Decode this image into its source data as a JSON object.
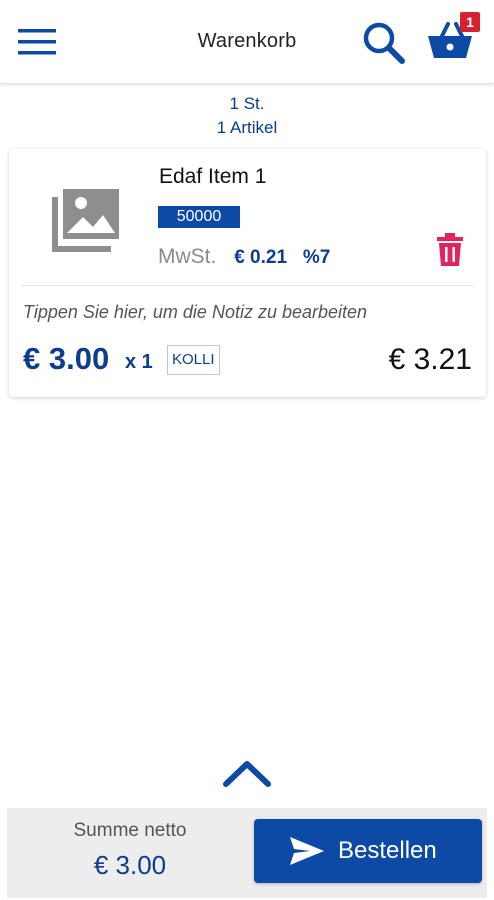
{
  "header": {
    "title": "Warenkorb",
    "menu_icon": "menu-icon",
    "search_icon": "search-icon",
    "cart_icon": "basket-icon",
    "cart_count": "1"
  },
  "summary": {
    "quantity": "1 St.",
    "articles": "1 Artikel"
  },
  "cart_items": [
    {
      "name": "Edaf Item 1",
      "sku": "50000",
      "tax_label": "MwSt.",
      "tax_amount": "€ 0.21",
      "tax_rate": "%7",
      "note_placeholder": "Tippen Sie hier, um die Notiz zu bearbeiten",
      "unit_price": "€ 3.00",
      "quantity": "x 1",
      "unit": "KOLLI",
      "line_total": "€ 3.21",
      "image_icon": "image-placeholder-icon",
      "delete_icon": "trash-icon"
    }
  ],
  "footer": {
    "sum_label": "Summe netto",
    "sum_value": "€ 3.00",
    "order_label": "Bestellen",
    "order_icon": "send-icon",
    "expand_icon": "chevron-up-icon"
  },
  "colors": {
    "primary": "#0d4aa5",
    "primary_text": "#0d3d8c",
    "badge": "#d4222f",
    "delete": "#e0245e",
    "footer_bg": "#ededed"
  }
}
